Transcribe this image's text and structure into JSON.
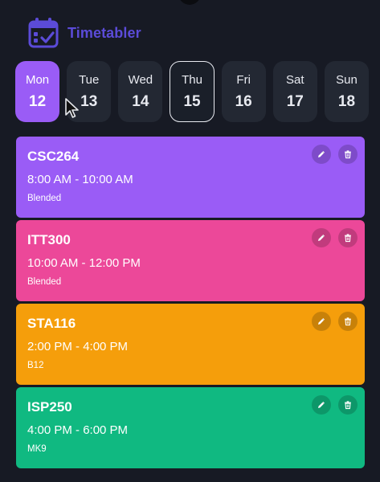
{
  "app": {
    "title": "Timetabler",
    "logo_icon": "calendar-check-icon"
  },
  "colors": {
    "background": "#171a24",
    "accent": "#9a5cf6",
    "day_tile": "#232833"
  },
  "days": [
    {
      "name": "Mon",
      "num": "12",
      "state": "selected"
    },
    {
      "name": "Tue",
      "num": "13",
      "state": ""
    },
    {
      "name": "Wed",
      "num": "14",
      "state": ""
    },
    {
      "name": "Thu",
      "num": "15",
      "state": "today"
    },
    {
      "name": "Fri",
      "num": "16",
      "state": ""
    },
    {
      "name": "Sat",
      "num": "17",
      "state": ""
    },
    {
      "name": "Sun",
      "num": "18",
      "state": ""
    }
  ],
  "classes": [
    {
      "code": "CSC264",
      "time": "8:00 AM - 10:00 AM",
      "location": "Blended",
      "color": "#9a5cf6"
    },
    {
      "code": "ITT300",
      "time": "10:00 AM - 12:00 PM",
      "location": "Blended",
      "color": "#ec4899"
    },
    {
      "code": "STA116",
      "time": "2:00 PM - 4:00 PM",
      "location": "B12",
      "color": "#f59e0b"
    },
    {
      "code": "ISP250",
      "time": "4:00 PM - 6:00 PM",
      "location": "MK9",
      "color": "#10b981"
    }
  ],
  "card_actions": {
    "edit_icon": "pencil-icon",
    "delete_icon": "trash-icon"
  }
}
